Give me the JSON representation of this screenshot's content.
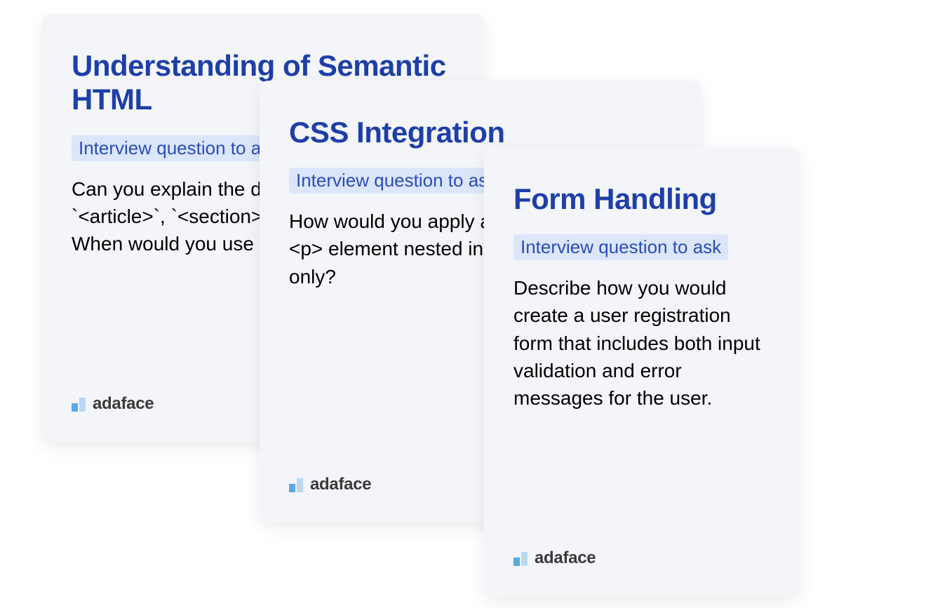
{
  "cards": [
    {
      "title": "Understanding of Semantic HTML",
      "badge": "Interview question to ask",
      "body": "Can you explain the difference between `<article>`, `<section>`, and `<div>` tags? When would you use each?"
    },
    {
      "title": "CSS Integration",
      "badge": "Interview question to ask",
      "body": "How would you apply a CSS style to every <p> element nested inside <article> tags only?"
    },
    {
      "title": "Form Handling",
      "badge": "Interview question to ask",
      "body": "Describe how you would create a user registration form that includes both input validation and error messages for the user."
    }
  ],
  "brand": "adaface"
}
